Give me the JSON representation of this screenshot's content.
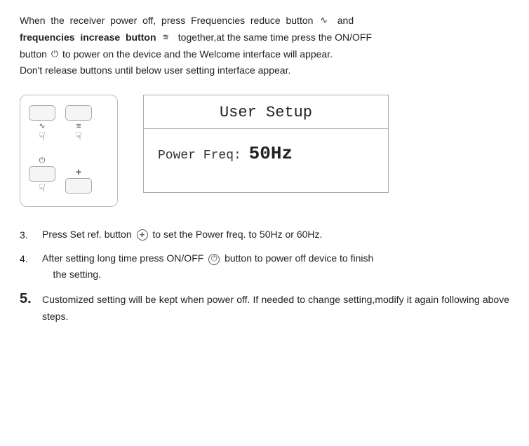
{
  "intro": {
    "line1": "When  the  receiver  power  off,  press  Frequencies  reduce  button",
    "reduce_icon": "∿",
    "and_text": "and",
    "line2_bold": "frequencies  increase  button",
    "increase_icon": "≋",
    "line2_rest": " together,at the same time press the ON/OFF",
    "line3": "button",
    "power_icon": "⏻",
    "line3_rest": " to power on the device and the Welcome interface will appear.",
    "line4": "Don't release buttons until below user setting interface appear."
  },
  "device": {
    "buttons": [
      {
        "symbol": "∿",
        "hand": "☞",
        "label": "reduce-freq-btn"
      },
      {
        "symbol": "≋",
        "hand": "☞",
        "label": "increase-freq-btn"
      }
    ],
    "bottom_buttons": [
      {
        "symbol": "⏻",
        "label": "power-btn"
      },
      {
        "symbol": "+",
        "label": "set-ref-btn"
      }
    ]
  },
  "user_setup_box": {
    "title": "User Setup",
    "power_freq_label": "Power Freq:",
    "power_freq_value": "50Hz"
  },
  "steps": [
    {
      "num": "3.",
      "text": "Press Set ref. button",
      "icon_type": "circle-plus",
      "text_after": " to set the Power freq. to 50Hz or 60Hz.",
      "large": false
    },
    {
      "num": "4.",
      "text": "After setting long time press ON/OFF",
      "icon_type": "circle-power",
      "text_after": " button to power off device to finish the setting.",
      "large": false
    },
    {
      "num": "5.",
      "text": "Customized setting will be kept when power off. If needed to change setting,modify it again following above steps.",
      "icon_type": null,
      "text_after": "",
      "large": true
    }
  ]
}
